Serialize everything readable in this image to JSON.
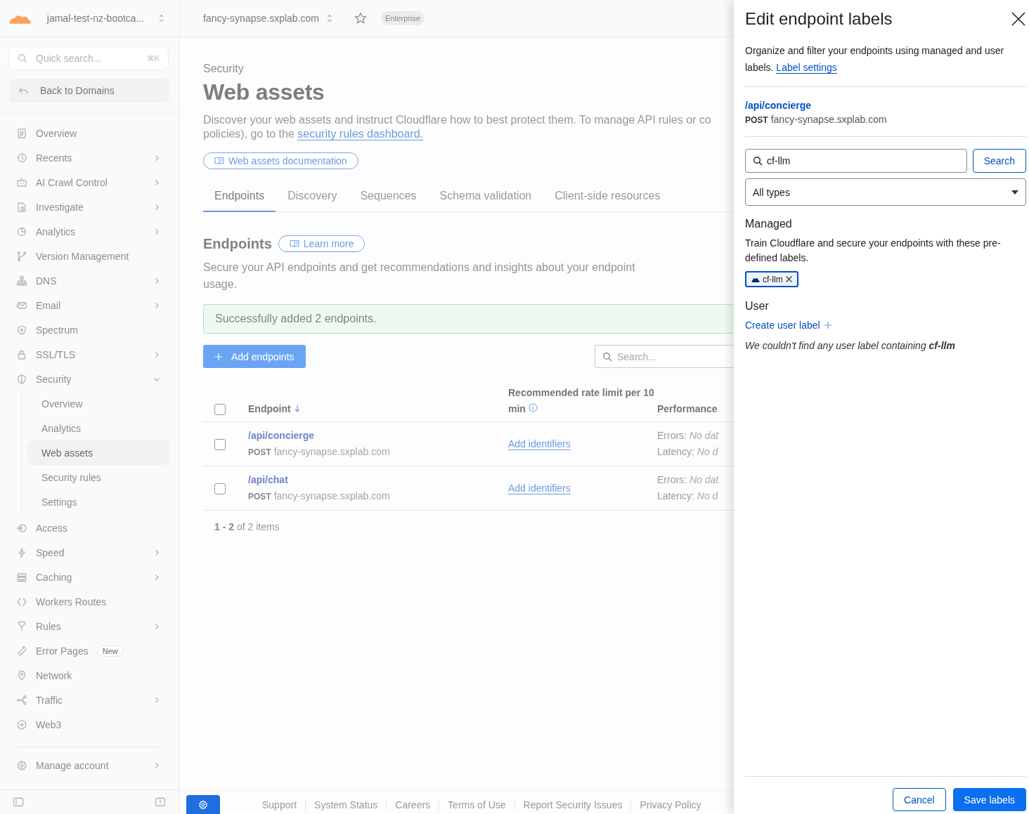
{
  "sidebar": {
    "account": "jamal-test-nz-bootca...",
    "quick_search": {
      "placeholder": "Quick search...",
      "shortcut": "⌘K"
    },
    "back_link": "Back to Domains",
    "items": [
      {
        "label": "Overview",
        "expandable": false,
        "selected": false
      },
      {
        "label": "Recents",
        "expandable": true,
        "selected": false
      },
      {
        "label": "AI Crawl Control",
        "expandable": true,
        "selected": false
      },
      {
        "label": "Investigate",
        "expandable": true,
        "selected": false
      },
      {
        "label": "Analytics",
        "expandable": true,
        "selected": false
      },
      {
        "label": "Version Management",
        "expandable": false,
        "selected": false
      },
      {
        "label": "DNS",
        "expandable": true,
        "selected": false
      },
      {
        "label": "Email",
        "expandable": true,
        "selected": false
      },
      {
        "label": "Spectrum",
        "expandable": false,
        "selected": false
      },
      {
        "label": "SSL/TLS",
        "expandable": true,
        "selected": false
      },
      {
        "label": "Security",
        "expandable": true,
        "expanded": true,
        "selected": false,
        "children": [
          {
            "label": "Overview",
            "selected": false
          },
          {
            "label": "Analytics",
            "selected": false
          },
          {
            "label": "Web assets",
            "selected": true
          },
          {
            "label": "Security rules",
            "selected": false
          },
          {
            "label": "Settings",
            "selected": false
          }
        ]
      },
      {
        "label": "Access",
        "expandable": false,
        "selected": false
      },
      {
        "label": "Speed",
        "expandable": true,
        "selected": false
      },
      {
        "label": "Caching",
        "expandable": true,
        "selected": false
      },
      {
        "label": "Workers Routes",
        "expandable": false,
        "selected": false
      },
      {
        "label": "Rules",
        "expandable": true,
        "selected": false
      },
      {
        "label": "Error Pages",
        "expandable": false,
        "selected": false,
        "badge": "New"
      },
      {
        "label": "Network",
        "expandable": false,
        "selected": false
      },
      {
        "label": "Traffic",
        "expandable": true,
        "selected": false
      },
      {
        "label": "Web3",
        "expandable": false,
        "selected": false
      }
    ],
    "manage_account": {
      "label": "Manage account",
      "expandable": true
    }
  },
  "header": {
    "domain": "fancy-synapse.sxplab.com",
    "plan": "Enterprise"
  },
  "page": {
    "breadcrumb": "Security",
    "title": "Web assets",
    "description": "Discover your web assets and instruct Cloudflare how to best protect them. To manage API rules or co",
    "description_cont": "policies), go to the",
    "description_link": "security rules dashboard.",
    "doc_button": "Web assets documentation",
    "tabs": [
      {
        "label": "Endpoints",
        "selected": true
      },
      {
        "label": "Discovery",
        "selected": false
      },
      {
        "label": "Sequences",
        "selected": false
      },
      {
        "label": "Schema validation",
        "selected": false
      },
      {
        "label": "Client-side resources",
        "selected": false
      }
    ]
  },
  "endpoints": {
    "title": "Endpoints",
    "learn_more": "Learn more",
    "description": "Secure your API endpoints and get recommendations and insights about your endpoint usage.",
    "alert": "Successfully added 2 endpoints.",
    "add_button": "Add endpoints",
    "search": {
      "placeholder": "Search..."
    },
    "table": {
      "columns": [
        "Endpoint",
        "Recommended rate limit per 10 min",
        "Performance"
      ],
      "all_checked": false,
      "rows": [
        {
          "checked": false,
          "path": "/api/concierge",
          "method": "POST",
          "host": "fancy-synapse.sxplab.com",
          "action": "Add identifiers",
          "errors_label": "Errors:",
          "errors_value": "No dat",
          "latency_label": "Latency:",
          "latency_value": "No d"
        },
        {
          "checked": false,
          "path": "/api/chat",
          "method": "POST",
          "host": "fancy-synapse.sxplab.com",
          "action": "Add identifiers",
          "errors_label": "Errors:",
          "errors_value": "No dat",
          "latency_label": "Latency:",
          "latency_value": "No d"
        }
      ]
    },
    "pagination": "**1 - 2** of 2 items"
  },
  "footer": {
    "links": [
      "Support",
      "System Status",
      "Careers",
      "Terms of Use",
      "Report Security Issues",
      "Privacy Policy"
    ]
  },
  "panel": {
    "title": "Edit endpoint labels",
    "description": "Organize and filter your endpoints using managed and user labels.",
    "settings_link": "Label settings",
    "endpoint": {
      "path": "/api/concierge",
      "method": "POST",
      "host": "fancy-synapse.sxplab.com"
    },
    "search": {
      "value": "cf-llm"
    },
    "search_button": "Search",
    "type_select": "All types",
    "managed": {
      "heading": "Managed",
      "description": "Train Cloudflare and secure your endpoints with these pre-defined labels.",
      "chips": [
        {
          "label": "cf-llm",
          "selected": true
        }
      ]
    },
    "user": {
      "heading": "User",
      "create_link": "Create user label",
      "empty_message": "We couldn't find any user label containing **cf-llm**"
    },
    "buttons": [
      {
        "label": "Cancel",
        "kind": "secondary"
      },
      {
        "label": "Save labels",
        "kind": "primary"
      }
    ]
  }
}
